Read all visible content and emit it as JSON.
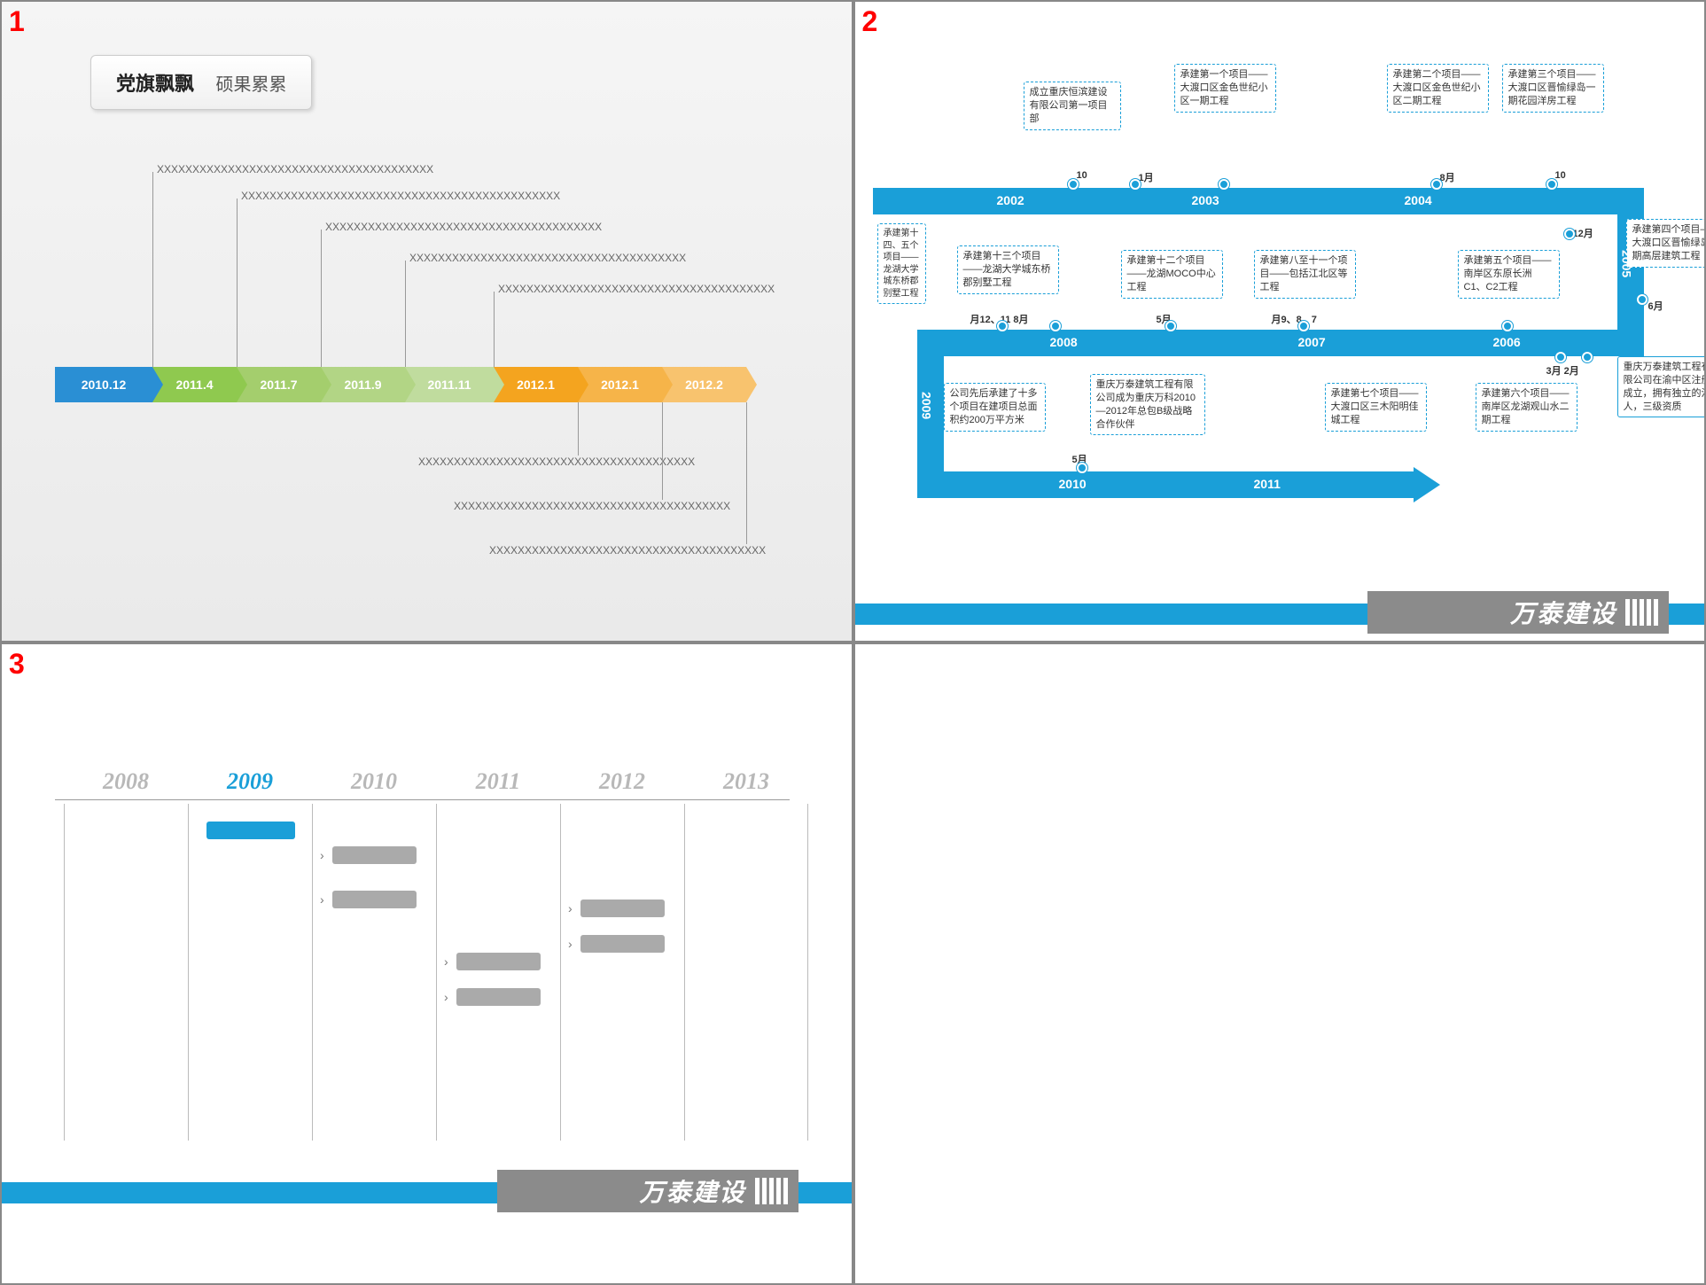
{
  "panels": {
    "n1": "1",
    "n2": "2",
    "n3": "3"
  },
  "panel1": {
    "title_bold": "党旗飘飘",
    "title_light": "硕果累累",
    "segments": [
      "2010.12",
      "2011.4",
      "2011.7",
      "2011.9",
      "2011.11",
      "2012.1",
      "2012.1",
      "2012.2"
    ],
    "placeholder_long": "XXXXXXXXXXXXXXXXXXXXXXXXXXXXXXXXXXXXXXX",
    "annotations_above": [
      "XXXXXXXXXXXXXXXXXXXXXXXXXXXXXXXXXXXXXXX",
      "XXXXXXXXXXXXXXXXXXXXXXXXXXXXXXXXXXXXXXXXXXXXX",
      "XXXXXXXXXXXXXXXXXXXXXXXXXXXXXXXXXXXXXXX",
      "XXXXXXXXXXXXXXXXXXXXXXXXXXXXXXXXXXXXXXX",
      "XXXXXXXXXXXXXXXXXXXXXXXXXXXXXXXXXXXXXXX"
    ],
    "annotations_below": [
      "XXXXXXXXXXXXXXXXXXXXXXXXXXXXXXXXXXXXXXX",
      "XXXXXXXXXXXXXXXXXXXXXXXXXXXXXXXXXXXXXXX",
      "XXXXXXXXXXXXXXXXXXXXXXXXXXXXXXXXXXXXXXX"
    ]
  },
  "panel2": {
    "years": [
      "2002",
      "2003",
      "2004",
      "2005",
      "2006",
      "2007",
      "2008",
      "2009",
      "2010",
      "2011"
    ],
    "brand": "万泰建设",
    "events": {
      "e1": "成立重庆恒滨建设有限公司第一项目部",
      "e2": "承建第一个项目——大渡口区金色世纪小区一期工程",
      "e3": "承建第二个项目——大渡口区金色世纪小区二期工程",
      "e4": "承建第三个项目——大渡口区晋愉绿岛一期花园洋房工程",
      "e5": "承建第四个项目——大渡口区晋愉绿岛二期高层建筑工程",
      "e6": "承建第五个项目——南岸区东原长洲C1、C2工程",
      "e7": "承建第八至十一个项目——包括江北区等工程",
      "e8": "承建第十二个项目——龙湖MOCO中心工程",
      "e9": "承建第十三个项目——龙湖大学城东桥郡别墅工程",
      "e10": "承建第十四、五个项目——龙湖大学城东桥郡别墅工程",
      "e11": "公司先后承建了十多个项目在建项目总面积约200万平方米",
      "e12": "重庆万泰建筑工程有限公司成为重庆万科2010—2012年总包B级战略合作伙伴",
      "e13": "承建第七个项目——大渡口区三木阳明佳城工程",
      "e14": "承建第六个项目——南岸区龙湖观山水二期工程",
      "e15": "重庆万泰建筑工程有限公司在渝中区注册成立，拥有独立的法人，三级资质"
    },
    "months": {
      "m1": "10",
      "m2": "1月",
      "m3": "8月",
      "m4": "10",
      "m5": "12月",
      "m6": "6月",
      "m7": "3月 2月",
      "m8": "月9、8、7",
      "m9": "5月",
      "m10": "月12、11 8月",
      "m11": "5月"
    }
  },
  "panel3": {
    "years": [
      "2008",
      "2009",
      "2010",
      "2011",
      "2012",
      "2013"
    ],
    "active_index": 1,
    "brand": "万泰建设"
  }
}
